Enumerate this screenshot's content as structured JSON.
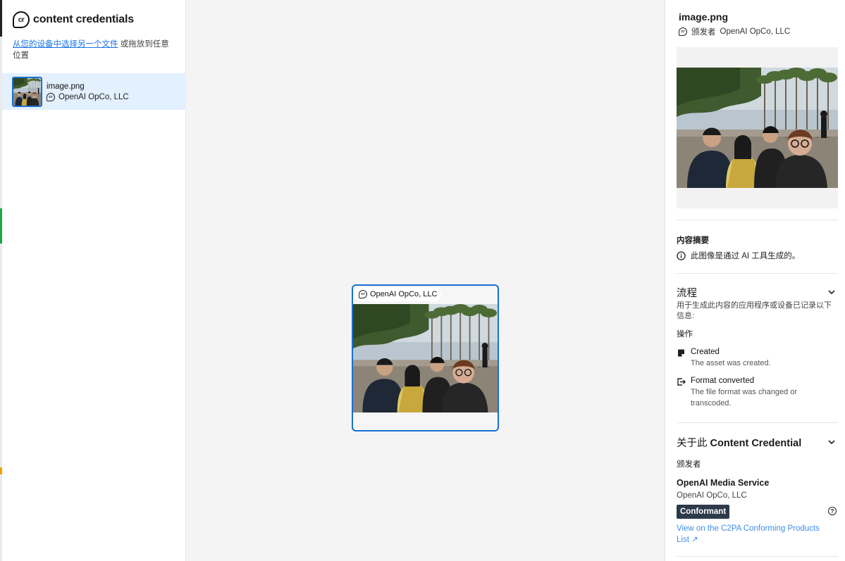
{
  "brand": {
    "logo_text": "cr",
    "name": "content credentials"
  },
  "upload": {
    "link_text": "从您的设备中选择另一个文件",
    "rest_text": " 或拖放到任意位置"
  },
  "file": {
    "name": "image.png",
    "issuer": "OpenAI OpCo, LLC"
  },
  "canvas_card": {
    "issuer": "OpenAI OpCo, LLC"
  },
  "panel": {
    "title": "image.png",
    "issuer_prefix": "颁发者",
    "issuer": "OpenAI OpCo, LLC",
    "summary": {
      "heading": "内容摘要",
      "text": "此图像是通过 AI 工具生成的。"
    },
    "process": {
      "heading": "流程",
      "description": "用于生成此内容的应用程序或设备已记录以下信息:",
      "actions_label": "操作",
      "actions": [
        {
          "title": "Created",
          "desc": "The asset was created.",
          "icon": "created-icon"
        },
        {
          "title": "Format converted",
          "desc": "The file format was changed or transcoded.",
          "icon": "format-converted-icon"
        }
      ]
    },
    "about": {
      "heading_prefix": "关于此 ",
      "heading_bold": "Content Credential",
      "issuer_label": "颁发者",
      "service_name": "OpenAI Media Service",
      "org": "OpenAI OpCo, LLC",
      "badge": "Conformant",
      "link": "View on the C2PA Conforming Products List ↗"
    }
  },
  "colors": {
    "accent": "#1a6fd1",
    "selected_bg": "#e3f0fd",
    "badge_bg": "#2d3a4a",
    "link": "#3d8ee8"
  }
}
